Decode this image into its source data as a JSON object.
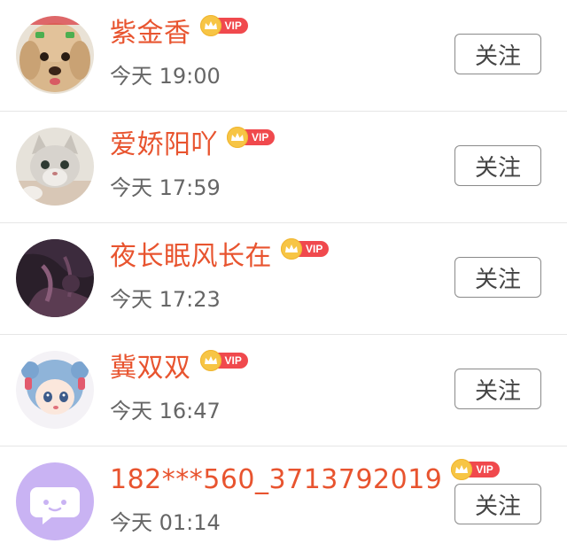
{
  "follow_list": [
    {
      "name": "紫金香",
      "vip": "VIP",
      "time": "今天 19:00",
      "button": "关注",
      "avatar_icon": "puppy-avatar"
    },
    {
      "name": "爱娇阳吖",
      "vip": "VIP",
      "time": "今天 17:59",
      "button": "关注",
      "avatar_icon": "kitten-avatar"
    },
    {
      "name": "夜长眠风长在",
      "vip": "VIP",
      "time": "今天 17:23",
      "button": "关注",
      "avatar_icon": "dark-abstract-avatar"
    },
    {
      "name": "冀双双",
      "vip": "VIP",
      "time": "今天 16:47",
      "button": "关注",
      "avatar_icon": "anime-girl-avatar"
    },
    {
      "name": "182***560_3713792019",
      "vip": "VIP",
      "time": "今天 01:14",
      "button": "关注",
      "avatar_icon": "chat-bubble-avatar"
    }
  ],
  "colors": {
    "name": "#e8542f",
    "vip_badge": "#f0494d",
    "vip_crown": "#f7c545",
    "time": "#666666",
    "button_border": "#8a8a8a",
    "default_avatar_bg": "#c9b3f3"
  }
}
